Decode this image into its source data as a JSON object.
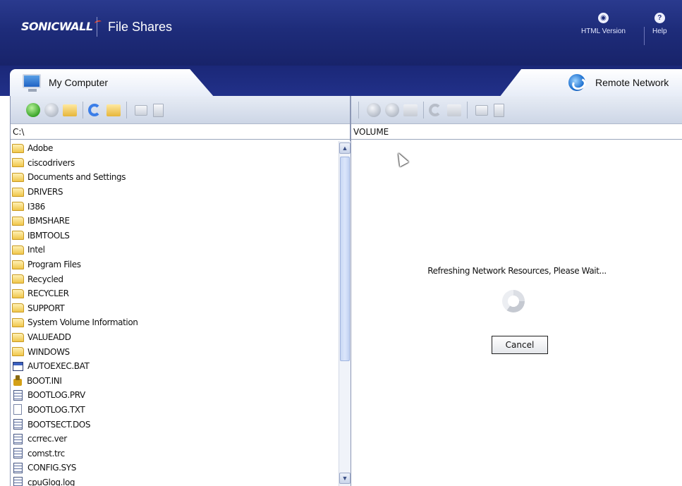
{
  "header": {
    "logo_text": "SONICWALL",
    "app_title": "File Shares",
    "html_version_label": "HTML Version",
    "help_label": "Help",
    "html_version_icon": "eye-icon",
    "help_icon": "question-icon"
  },
  "tabs": {
    "left_label": "My Computer",
    "right_label": "Remote Network"
  },
  "left_pane": {
    "path": "C:\\",
    "items": [
      {
        "name": "Adobe",
        "type": "folder"
      },
      {
        "name": "ciscodrivers",
        "type": "folder"
      },
      {
        "name": "Documents and Settings",
        "type": "folder"
      },
      {
        "name": "DRIVERS",
        "type": "folder"
      },
      {
        "name": "I386",
        "type": "folder"
      },
      {
        "name": "IBMSHARE",
        "type": "folder"
      },
      {
        "name": "IBMTOOLS",
        "type": "folder"
      },
      {
        "name": "Intel",
        "type": "folder"
      },
      {
        "name": "Program Files",
        "type": "folder"
      },
      {
        "name": "Recycled",
        "type": "folder"
      },
      {
        "name": "RECYCLER",
        "type": "folder"
      },
      {
        "name": "SUPPORT",
        "type": "folder"
      },
      {
        "name": "System Volume Information",
        "type": "folder"
      },
      {
        "name": "VALUEADD",
        "type": "folder"
      },
      {
        "name": "WINDOWS",
        "type": "folder"
      },
      {
        "name": "AUTOEXEC.BAT",
        "type": "bat"
      },
      {
        "name": "BOOT.INI",
        "type": "ini"
      },
      {
        "name": "BOOTLOG.PRV",
        "type": "file"
      },
      {
        "name": "BOOTLOG.TXT",
        "type": "txt"
      },
      {
        "name": "BOOTSECT.DOS",
        "type": "file"
      },
      {
        "name": "ccrrec.ver",
        "type": "file"
      },
      {
        "name": "comst.trc",
        "type": "file"
      },
      {
        "name": "CONFIG.SYS",
        "type": "file"
      },
      {
        "name": "cpuGlog.log",
        "type": "file"
      }
    ]
  },
  "right_pane": {
    "column_header": "VOLUME",
    "status": "Refreshing Network Resources, Please Wait...",
    "cancel_label": "Cancel"
  },
  "colors": {
    "header_bg": "#1e2c7a",
    "accent_green": "#3aa52a",
    "accent_blue": "#3b7ee8"
  }
}
